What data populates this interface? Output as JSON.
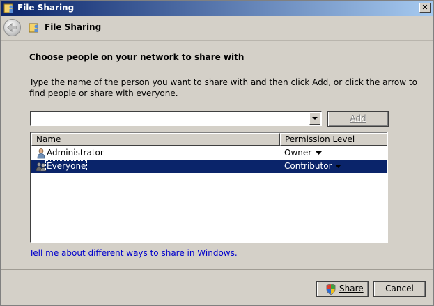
{
  "window": {
    "title": "File Sharing",
    "close_label": "✕"
  },
  "nav": {
    "title": "File Sharing"
  },
  "content": {
    "heading": "Choose people on your network to share with",
    "instructions": "Type the name of the person you want to share with and then click Add, or click the arrow to find people or share with everyone.",
    "combo_value": "",
    "add_label": "Add",
    "columns": {
      "name": "Name",
      "permission": "Permission Level"
    },
    "rows": [
      {
        "name": "Administrator",
        "permission": "Owner",
        "selected": false
      },
      {
        "name": "Everyone",
        "permission": "Contributor",
        "selected": true
      }
    ],
    "help_link": "Tell me about different ways to share in Windows."
  },
  "footer": {
    "share_label": "Share",
    "cancel_label": "Cancel"
  },
  "colors": {
    "selection": "#0a246a",
    "dialog_bg": "#d4d0c8",
    "link": "#0000cc"
  }
}
